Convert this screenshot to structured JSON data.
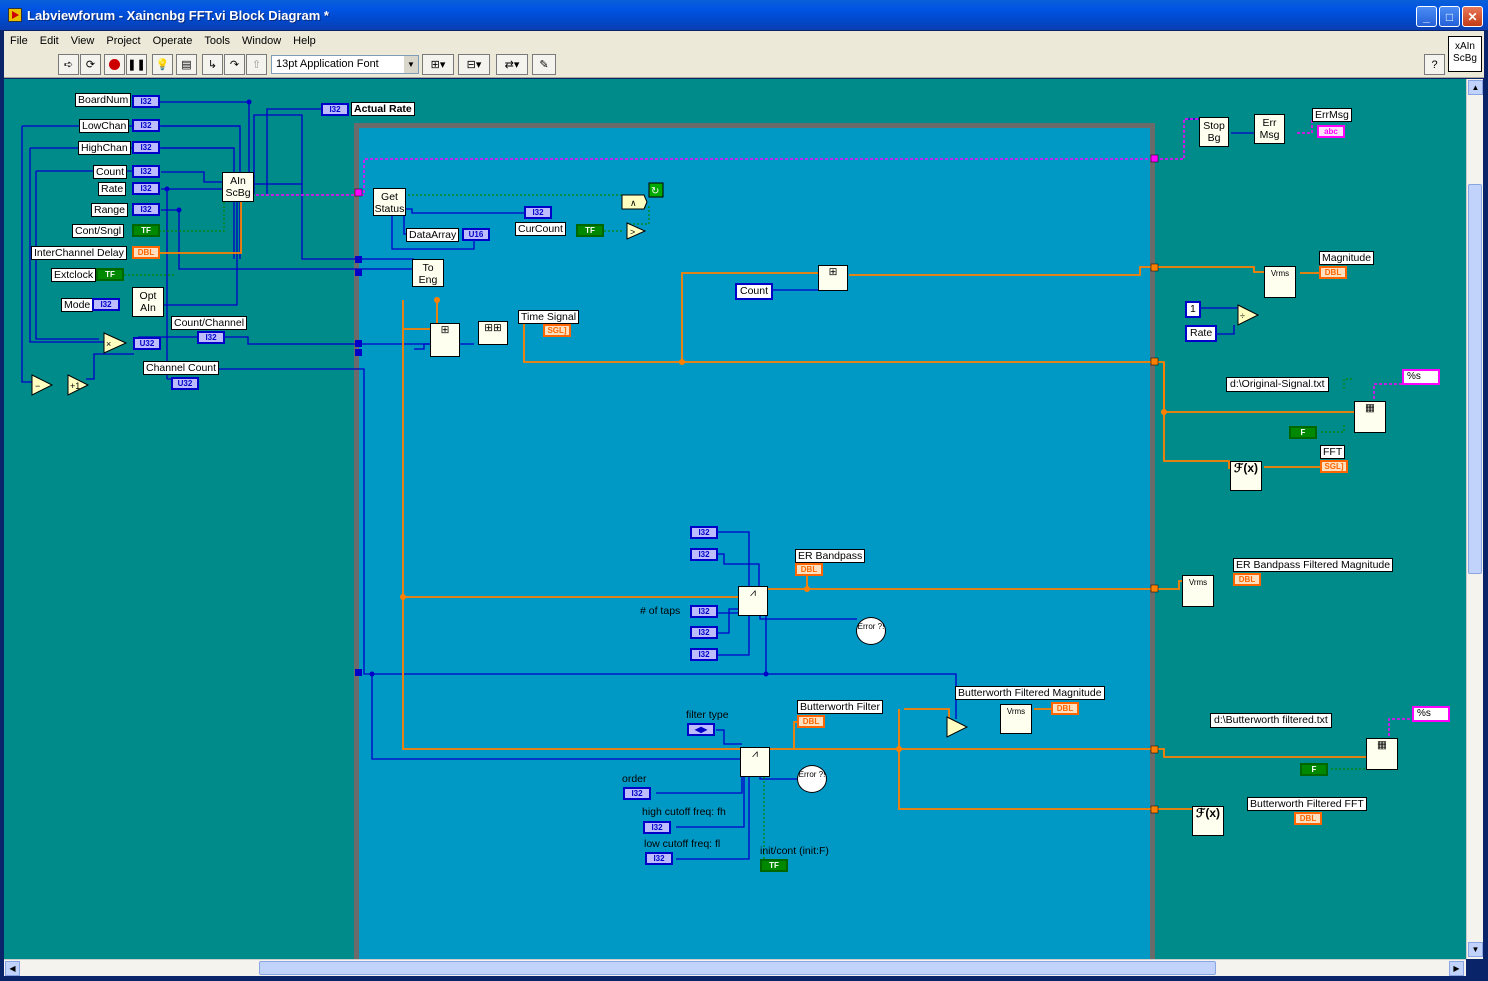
{
  "window": {
    "title": "Labviewforum - Xaincnbg FFT.vi Block Diagram *",
    "minimize": "_",
    "maximize": "□",
    "close": "✕"
  },
  "menu": [
    "File",
    "Edit",
    "View",
    "Project",
    "Operate",
    "Tools",
    "Window",
    "Help"
  ],
  "toolbar": {
    "font": "13pt Application Font",
    "help": "?"
  },
  "vi_icon": {
    "line1": "xAIn",
    "line2": "ScBg"
  },
  "controls": {
    "boardnum": "BoardNum",
    "lowchan": "LowChan",
    "highchan": "HighChan",
    "count": "Count",
    "rate": "Rate",
    "range": "Range",
    "contsngl": "Cont/Sngl",
    "interchannel": "InterChannel Delay",
    "extclock": "Extclock",
    "mode": "Mode",
    "count_channel": "Count/Channel",
    "channel_count": "Channel Count",
    "actual_rate": "Actual Rate"
  },
  "types": {
    "i32": "I32",
    "u32": "U32",
    "u16": "U16",
    "dbl": "DBL",
    "sgl": "SGL]",
    "tf": "TF",
    "tf_short": "F",
    "abc": "abc",
    "ring": "◀▶"
  },
  "nodes": {
    "ain_scbg": [
      "AIn",
      "ScBg"
    ],
    "opt_ain": [
      "Opt",
      "AIn"
    ],
    "get_status": [
      "Get",
      "Status"
    ],
    "to_eng": [
      "To",
      "Eng"
    ],
    "stop_bg": [
      "Stop",
      "Bg"
    ],
    "err_msg": [
      "Err",
      "Msg"
    ],
    "inc": "+1",
    "dec": "-",
    "fx": "ℱ(x)",
    "vrms": "Vrms"
  },
  "loop": {
    "dataarray": "DataArray",
    "curcount": "CurCount",
    "count_const": "Count",
    "time_signal": "Time Signal",
    "er_bandpass": "ER Bandpass",
    "num_taps": "# of taps",
    "filter_type": "filter type",
    "butterworth_filter": "Butterworth Filter",
    "butterworth_mag": "Butterworth Filtered Magnitude",
    "order": "order",
    "high_cutoff": "high cutoff freq: fh",
    "low_cutoff": "low cutoff freq: fl",
    "init_cont": "init/cont (init:F)",
    "error": "Error ?!"
  },
  "right": {
    "errmsg": "ErrMsg",
    "magnitude": "Magnitude",
    "const_1": "1",
    "rate": "Rate",
    "path1": "d:\\Original-Signal.txt",
    "fmt1": "%s",
    "fft": "FFT",
    "er_bandpass_mag": "ER Bandpass Filtered Magnitude",
    "path2": "d:\\Butterworth filtered.txt",
    "fmt2": "%s",
    "butterworth_fft": "Butterworth Filtered FFT"
  }
}
